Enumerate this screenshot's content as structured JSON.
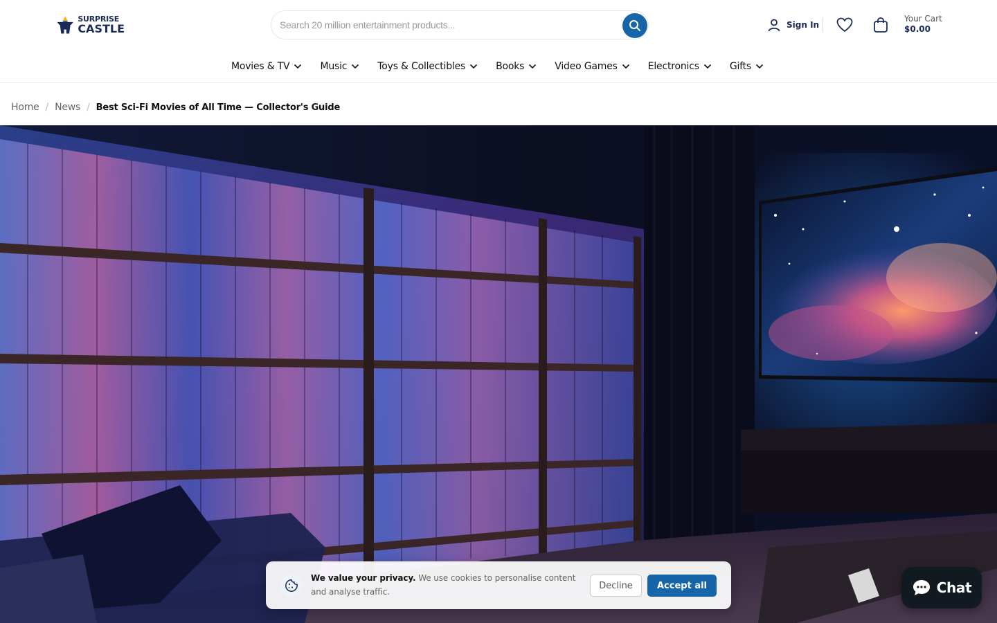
{
  "brand": {
    "line1": "SURPRISE",
    "line2": "CASTLE",
    "navy": "#1b2a57",
    "gold": "#f5b400",
    "accent": "#1665a8"
  },
  "search": {
    "placeholder": "Search 20 million entertainment products...",
    "value": "",
    "icon": "search-icon"
  },
  "account": {
    "sign_in_label": "Sign In",
    "icon": "user-icon"
  },
  "wishlist": {
    "icon": "heart-icon"
  },
  "cart": {
    "label": "Your Cart",
    "total": "$0.00",
    "icon": "shopping-bag-icon"
  },
  "nav": {
    "items": [
      {
        "label": "Movies & TV"
      },
      {
        "label": "Music"
      },
      {
        "label": "Toys & Collectibles"
      },
      {
        "label": "Books"
      },
      {
        "label": "Video Games"
      },
      {
        "label": "Electronics"
      },
      {
        "label": "Gifts"
      }
    ]
  },
  "breadcrumb": {
    "items": [
      "Home",
      "News"
    ],
    "separator": "/",
    "current": "Best Sci-Fi Movies of All Time — Collector's Guide"
  },
  "cookie": {
    "title": "We value your privacy.",
    "message": "We use cookies to personalise content and analyse traffic.",
    "decline_label": "Decline",
    "accept_label": "Accept all",
    "icon": "cookie-icon"
  },
  "chat": {
    "label": "Chat",
    "icon": "chat-bubble-icon"
  }
}
